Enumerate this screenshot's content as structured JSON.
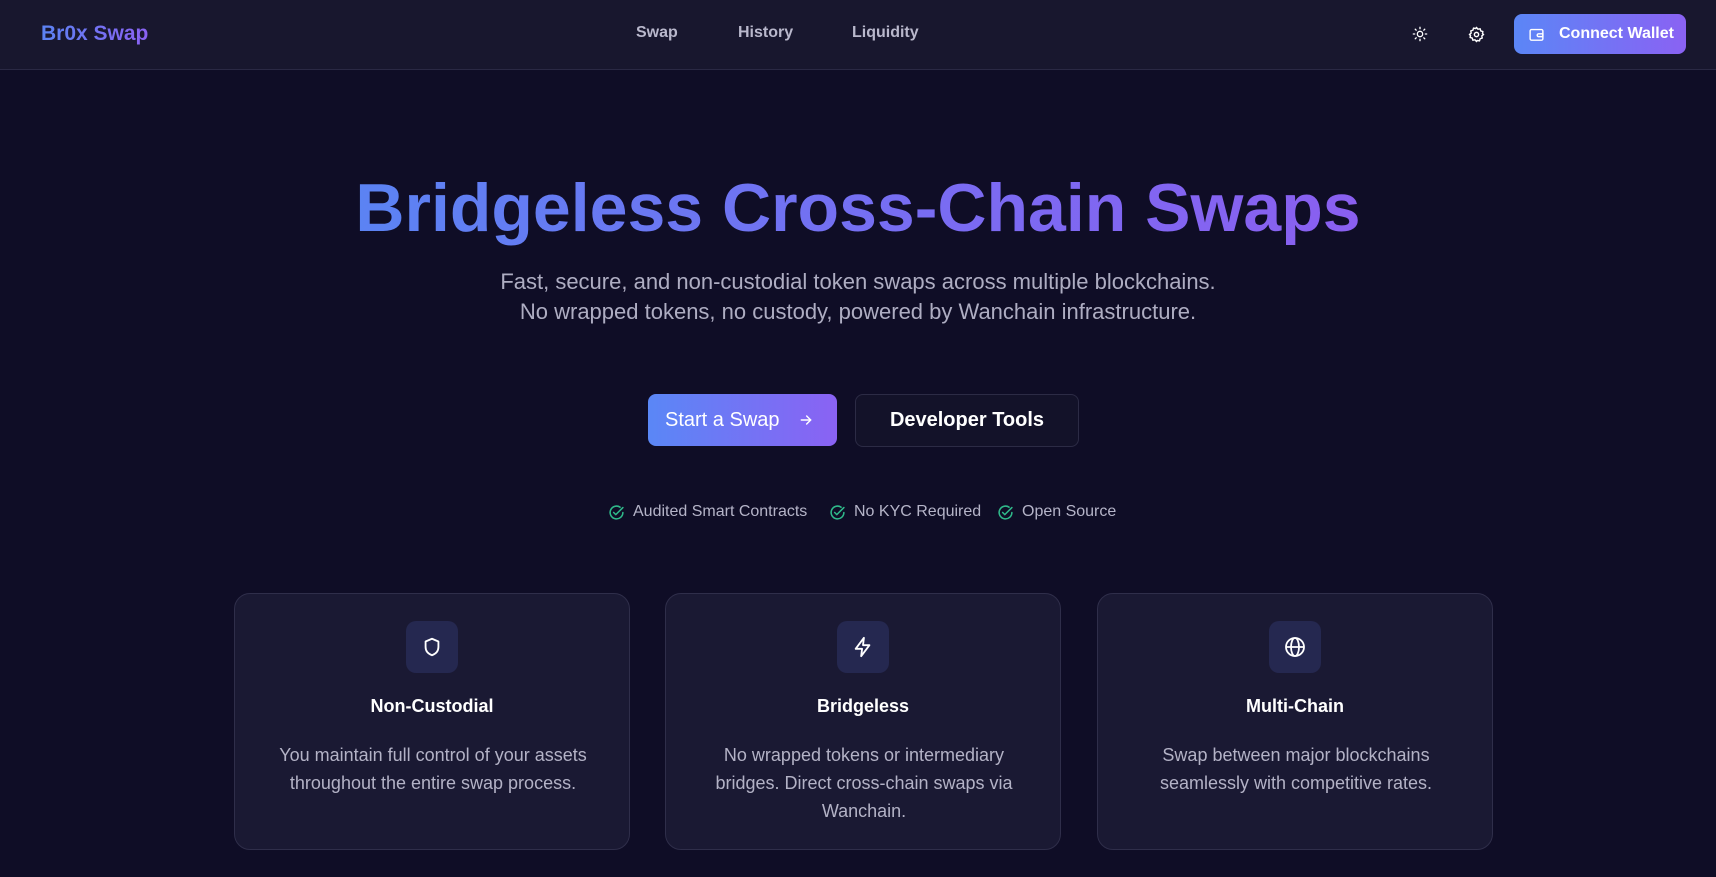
{
  "header": {
    "logo": "Br0x Swap",
    "nav": [
      {
        "label": "Swap"
      },
      {
        "label": "History"
      },
      {
        "label": "Liquidity"
      }
    ],
    "theme_icon": "sun-icon",
    "settings_icon": "gear-icon",
    "wallet_icon": "wallet-icon",
    "connect_label": "Connect Wallet"
  },
  "hero": {
    "title": "Bridgeless Cross-Chain Swaps",
    "subtitle": "Fast, secure, and non-custodial token swaps across multiple blockchains. No wrapped tokens, no custody, powered by Wanchain infrastructure.",
    "primary_cta": "Start a Swap",
    "secondary_cta": "Developer Tools",
    "badges": [
      {
        "label": "Audited Smart Contracts",
        "icon": "check-circle-icon"
      },
      {
        "label": "No KYC Required",
        "icon": "check-circle-icon"
      },
      {
        "label": "Open Source",
        "icon": "check-circle-icon"
      }
    ]
  },
  "features": [
    {
      "icon": "shield-icon",
      "title": "Non-Custodial",
      "description": "You maintain full control of your assets throughout the entire swap process."
    },
    {
      "icon": "lightning-icon",
      "title": "Bridgeless",
      "description": "No wrapped tokens or intermediary bridges. Direct cross-chain swaps via Wanchain."
    },
    {
      "icon": "globe-icon",
      "title": "Multi-Chain",
      "description": "Swap between major blockchains seamlessly with competitive rates."
    }
  ],
  "colors": {
    "background": "#0f0d26",
    "header": "#18172e",
    "gradient_start": "#5b83f3",
    "gradient_end": "#8a62f3",
    "check_green": "#2fb98a"
  }
}
